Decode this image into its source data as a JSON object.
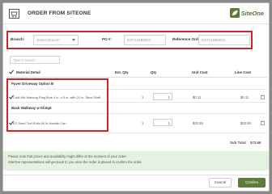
{
  "dialog": {
    "title": "ORDER FROM SITEONE",
    "logo": "SiteOne"
  },
  "filters": {
    "branch_label": "Branch:",
    "branch_value": "Select Branch",
    "po_label": "PO #:",
    "po_value": "EST21999022",
    "reference_label": "Reference Order:",
    "reference_value": "EST21999022"
  },
  "search": {
    "placeholder": "Type to search"
  },
  "table": {
    "headers": {
      "material": "Material Detail",
      "est_qty": "Est. Qty",
      "qty": "Qty",
      "unit_cost": "Unit Cost",
      "line_cost": "Line Cost"
    },
    "groups": [
      {
        "name": "Paver Driveway Option B",
        "items": [
          {
            "desc": "Cold Mix Marking Flag Blue 4 in. x 5 in. with 21 in. Steel Staff",
            "est_qty": "1",
            "qty": "1",
            "unit_cost": "$0.11",
            "line_cost": "$0.11"
          }
        ]
      },
      {
        "name": "Back Walkway w Klimpt",
        "items": [
          {
            "desc": "EZ Seed Turf Rolls 60 lb Handle Can",
            "est_qty": "1",
            "qty": "1",
            "unit_cost": "$23.55",
            "line_cost": "$23.55"
          }
        ]
      }
    ],
    "subtotal_label": "Sub Total",
    "subtotal_value": "$73.66"
  },
  "notice": {
    "line1": "Please note that prices and availability might differ at the moment of your order.",
    "line2": "SiteOne representatives will get back to you once the order is placed to confirm the order."
  },
  "buttons": {
    "cancel": "Cancel",
    "confirm": "Confirm"
  },
  "colors": {
    "brand": "#5e7b3c",
    "highlight": "#d2232a",
    "notice_bg": "#e6f2e1"
  },
  "icons": {
    "header": "cart-icon",
    "logo": "siteone-leaf-icon",
    "row_action": "trash-icon"
  }
}
